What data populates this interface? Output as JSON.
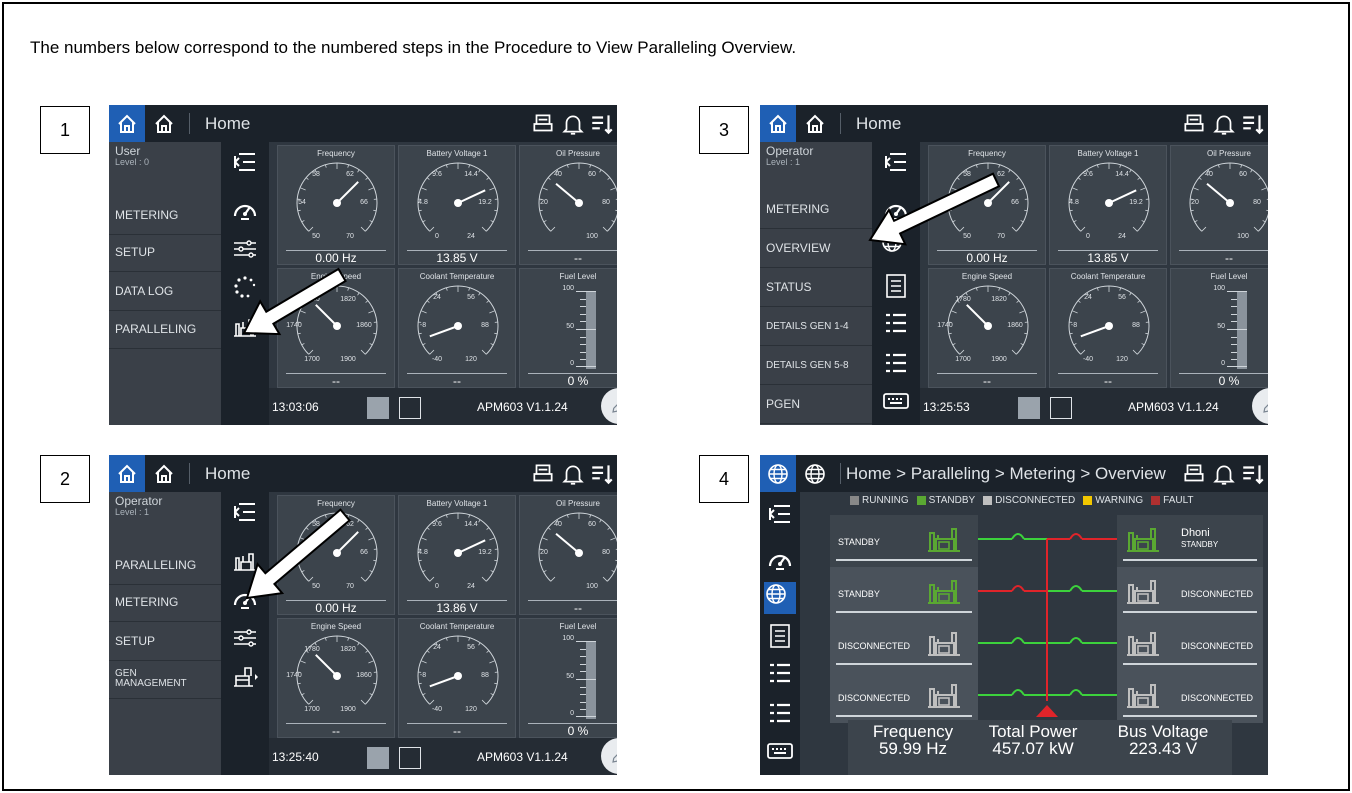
{
  "instruction": "The numbers below correspond to the numbered steps in the Procedure to View Paralleling Overview.",
  "screens": [
    {
      "step": "1",
      "breadcrumb": "Home",
      "user": {
        "name": "User",
        "level": "Level : 0"
      },
      "nav": [
        "METERING",
        "SETUP",
        "DATA LOG",
        "PARALLELING"
      ],
      "icons": [
        "collapse-menu-icon",
        "gauge-icon",
        "sliders-icon",
        "dots-circle-icon",
        "paralleling-icon"
      ],
      "panels": [
        {
          "title": "Frequency",
          "ticks": [
            "58",
            "62",
            "54",
            "66",
            "50",
            "70"
          ],
          "value": "0.00 Hz"
        },
        {
          "title": "Battery Voltage 1",
          "ticks": [
            "9.6",
            "14.4",
            "4.8",
            "19.2",
            "0",
            "24"
          ],
          "value": "13.85 V"
        },
        {
          "title": "Oil Pressure",
          "ticks": [
            "40",
            "60",
            "20",
            "80",
            "",
            "100"
          ],
          "value": "--"
        },
        {
          "title": "Engine Speed",
          "ticks": [
            "1780",
            "1820",
            "1740",
            "1860",
            "1700",
            "1900"
          ],
          "value": "--"
        },
        {
          "title": "Coolant Temperature",
          "ticks": [
            "24",
            "56",
            "-8",
            "88",
            "-40",
            "120"
          ],
          "value": "--"
        },
        {
          "title": "Fuel Level",
          "ticks": [
            "100",
            "50",
            "0"
          ],
          "value": "0 %"
        }
      ],
      "time": "13:03:06",
      "version": "APM603 V1.1.24"
    },
    {
      "step": "2",
      "breadcrumb": "Home",
      "user": {
        "name": "Operator",
        "level": "Level : 1"
      },
      "nav": [
        "PARALLELING",
        "METERING",
        "SETUP",
        "GEN MANAGEMENT"
      ],
      "icons": [
        "collapse-menu-icon",
        "paralleling-icon",
        "gauge-icon",
        "sliders-icon",
        "gen-management-icon"
      ],
      "panels": [
        {
          "title": "Frequency",
          "ticks": [
            "58",
            "62",
            "54",
            "66",
            "50",
            "70"
          ],
          "value": "0.00 Hz"
        },
        {
          "title": "Battery Voltage 1",
          "ticks": [
            "9.6",
            "14.4",
            "4.8",
            "19.2",
            "0",
            "24"
          ],
          "value": "13.86 V"
        },
        {
          "title": "Oil Pressure",
          "ticks": [
            "40",
            "60",
            "20",
            "80",
            "",
            "100"
          ],
          "value": "--"
        },
        {
          "title": "Engine Speed",
          "ticks": [
            "1780",
            "1820",
            "1740",
            "1860",
            "1700",
            "1900"
          ],
          "value": "--"
        },
        {
          "title": "Coolant Temperature",
          "ticks": [
            "24",
            "56",
            "-8",
            "88",
            "-40",
            "120"
          ],
          "value": "--"
        },
        {
          "title": "Fuel Level",
          "ticks": [
            "100",
            "50",
            "0"
          ],
          "value": "0 %"
        }
      ],
      "time": "13:25:40",
      "version": "APM603 V1.1.24"
    },
    {
      "step": "3",
      "breadcrumb": "Home",
      "user": {
        "name": "Operator",
        "level": "Level : 1"
      },
      "nav": [
        "METERING",
        "OVERVIEW",
        "STATUS",
        "DETAILS GEN 1-4",
        "DETAILS GEN 5-8",
        "PGEN"
      ],
      "icons": [
        "collapse-menu-icon",
        "gauge-icon",
        "globe-icon",
        "list-icon",
        "details-icon",
        "details-icon",
        "keyboard-icon"
      ],
      "panels": [
        {
          "title": "Frequency",
          "ticks": [
            "58",
            "62",
            "54",
            "66",
            "50",
            "70"
          ],
          "value": "0.00 Hz"
        },
        {
          "title": "Battery Voltage 1",
          "ticks": [
            "9.6",
            "14.4",
            "4.8",
            "19.2",
            "0",
            "24"
          ],
          "value": "13.85 V"
        },
        {
          "title": "Oil Pressure",
          "ticks": [
            "40",
            "60",
            "20",
            "80",
            "",
            "100"
          ],
          "value": "--"
        },
        {
          "title": "Engine Speed",
          "ticks": [
            "1780",
            "1820",
            "1740",
            "1860",
            "1700",
            "1900"
          ],
          "value": "--"
        },
        {
          "title": "Coolant Temperature",
          "ticks": [
            "24",
            "56",
            "-8",
            "88",
            "-40",
            "120"
          ],
          "value": "--"
        },
        {
          "title": "Fuel Level",
          "ticks": [
            "100",
            "50",
            "0"
          ],
          "value": "0 %"
        }
      ],
      "time": "13:25:53",
      "version": "APM603 V1.1.24"
    },
    {
      "step": "4",
      "breadcrumb": "Home > Paralleling > Metering > Overview",
      "legend": [
        "RUNNING",
        "STANDBY",
        "DISCONNECTED",
        "WARNING",
        "FAULT"
      ],
      "left_gens": [
        "STANDBY",
        "STANDBY",
        "DISCONNECTED",
        "DISCONNECTED"
      ],
      "right_gens": [
        "STANDBY",
        "DISCONNECTED",
        "DISCONNECTED",
        "DISCONNECTED"
      ],
      "right_gen_name": "Dhoni",
      "readouts": [
        {
          "label": "Frequency",
          "value": "59.99 Hz"
        },
        {
          "label": "Total Power",
          "value": "457.07 kW"
        },
        {
          "label": "Bus Voltage",
          "value": "223.43 V"
        }
      ]
    }
  ],
  "colors": {
    "standby": "#5aa832",
    "running": "#888888",
    "disconnected": "#bfbfbf",
    "warning": "#f2c700",
    "fault": "#b03030",
    "bus_red": "#e0242a",
    "bus_green": "#3cd23c",
    "accent": "#1f5fb4"
  }
}
